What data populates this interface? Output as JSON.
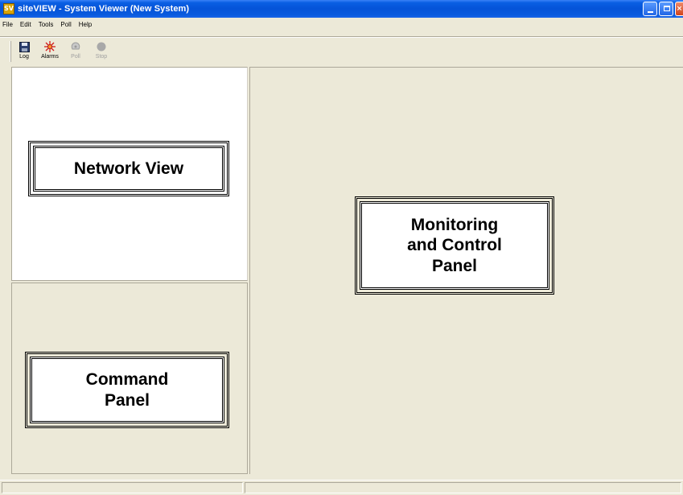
{
  "window": {
    "title": "siteVIEW - System Viewer (New System)",
    "app_icon_text": "SV"
  },
  "menu": {
    "items": [
      "File",
      "Edit",
      "Tools",
      "Poll",
      "Help"
    ]
  },
  "toolbar": {
    "buttons": [
      {
        "label": "Log",
        "icon": "floppy-disk-icon",
        "enabled": true
      },
      {
        "label": "Alarms",
        "icon": "alarm-burst-icon",
        "enabled": true
      },
      {
        "label": "Poll",
        "icon": "poll-icon",
        "enabled": false
      },
      {
        "label": "Stop",
        "icon": "stop-icon",
        "enabled": false
      }
    ]
  },
  "panels": {
    "network_view": "Network View",
    "command_panel": "Command\nPanel",
    "monitoring_panel": "Monitoring\nand Control\nPanel"
  },
  "colors": {
    "titlebar": "#0553d8",
    "window_bg": "#ece9d8",
    "alarm_red": "#d41c1c"
  }
}
